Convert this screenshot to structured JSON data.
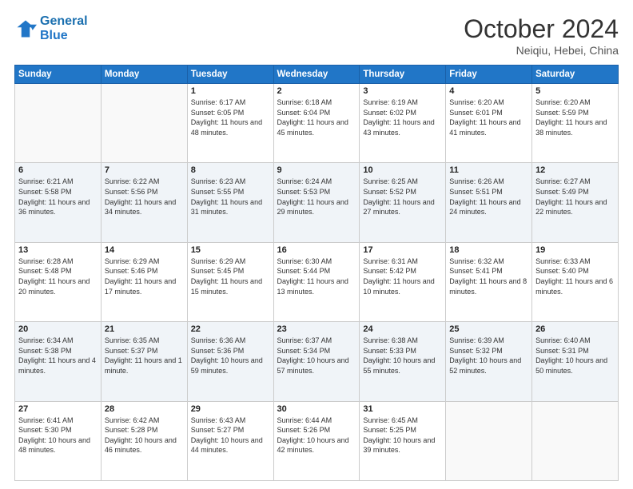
{
  "header": {
    "logo_line1": "General",
    "logo_line2": "Blue",
    "month": "October 2024",
    "location": "Neiqiu, Hebei, China"
  },
  "weekdays": [
    "Sunday",
    "Monday",
    "Tuesday",
    "Wednesday",
    "Thursday",
    "Friday",
    "Saturday"
  ],
  "weeks": [
    [
      {
        "day": "",
        "info": ""
      },
      {
        "day": "",
        "info": ""
      },
      {
        "day": "1",
        "info": "Sunrise: 6:17 AM\nSunset: 6:05 PM\nDaylight: 11 hours and 48 minutes."
      },
      {
        "day": "2",
        "info": "Sunrise: 6:18 AM\nSunset: 6:04 PM\nDaylight: 11 hours and 45 minutes."
      },
      {
        "day": "3",
        "info": "Sunrise: 6:19 AM\nSunset: 6:02 PM\nDaylight: 11 hours and 43 minutes."
      },
      {
        "day": "4",
        "info": "Sunrise: 6:20 AM\nSunset: 6:01 PM\nDaylight: 11 hours and 41 minutes."
      },
      {
        "day": "5",
        "info": "Sunrise: 6:20 AM\nSunset: 5:59 PM\nDaylight: 11 hours and 38 minutes."
      }
    ],
    [
      {
        "day": "6",
        "info": "Sunrise: 6:21 AM\nSunset: 5:58 PM\nDaylight: 11 hours and 36 minutes."
      },
      {
        "day": "7",
        "info": "Sunrise: 6:22 AM\nSunset: 5:56 PM\nDaylight: 11 hours and 34 minutes."
      },
      {
        "day": "8",
        "info": "Sunrise: 6:23 AM\nSunset: 5:55 PM\nDaylight: 11 hours and 31 minutes."
      },
      {
        "day": "9",
        "info": "Sunrise: 6:24 AM\nSunset: 5:53 PM\nDaylight: 11 hours and 29 minutes."
      },
      {
        "day": "10",
        "info": "Sunrise: 6:25 AM\nSunset: 5:52 PM\nDaylight: 11 hours and 27 minutes."
      },
      {
        "day": "11",
        "info": "Sunrise: 6:26 AM\nSunset: 5:51 PM\nDaylight: 11 hours and 24 minutes."
      },
      {
        "day": "12",
        "info": "Sunrise: 6:27 AM\nSunset: 5:49 PM\nDaylight: 11 hours and 22 minutes."
      }
    ],
    [
      {
        "day": "13",
        "info": "Sunrise: 6:28 AM\nSunset: 5:48 PM\nDaylight: 11 hours and 20 minutes."
      },
      {
        "day": "14",
        "info": "Sunrise: 6:29 AM\nSunset: 5:46 PM\nDaylight: 11 hours and 17 minutes."
      },
      {
        "day": "15",
        "info": "Sunrise: 6:29 AM\nSunset: 5:45 PM\nDaylight: 11 hours and 15 minutes."
      },
      {
        "day": "16",
        "info": "Sunrise: 6:30 AM\nSunset: 5:44 PM\nDaylight: 11 hours and 13 minutes."
      },
      {
        "day": "17",
        "info": "Sunrise: 6:31 AM\nSunset: 5:42 PM\nDaylight: 11 hours and 10 minutes."
      },
      {
        "day": "18",
        "info": "Sunrise: 6:32 AM\nSunset: 5:41 PM\nDaylight: 11 hours and 8 minutes."
      },
      {
        "day": "19",
        "info": "Sunrise: 6:33 AM\nSunset: 5:40 PM\nDaylight: 11 hours and 6 minutes."
      }
    ],
    [
      {
        "day": "20",
        "info": "Sunrise: 6:34 AM\nSunset: 5:38 PM\nDaylight: 11 hours and 4 minutes."
      },
      {
        "day": "21",
        "info": "Sunrise: 6:35 AM\nSunset: 5:37 PM\nDaylight: 11 hours and 1 minute."
      },
      {
        "day": "22",
        "info": "Sunrise: 6:36 AM\nSunset: 5:36 PM\nDaylight: 10 hours and 59 minutes."
      },
      {
        "day": "23",
        "info": "Sunrise: 6:37 AM\nSunset: 5:34 PM\nDaylight: 10 hours and 57 minutes."
      },
      {
        "day": "24",
        "info": "Sunrise: 6:38 AM\nSunset: 5:33 PM\nDaylight: 10 hours and 55 minutes."
      },
      {
        "day": "25",
        "info": "Sunrise: 6:39 AM\nSunset: 5:32 PM\nDaylight: 10 hours and 52 minutes."
      },
      {
        "day": "26",
        "info": "Sunrise: 6:40 AM\nSunset: 5:31 PM\nDaylight: 10 hours and 50 minutes."
      }
    ],
    [
      {
        "day": "27",
        "info": "Sunrise: 6:41 AM\nSunset: 5:30 PM\nDaylight: 10 hours and 48 minutes."
      },
      {
        "day": "28",
        "info": "Sunrise: 6:42 AM\nSunset: 5:28 PM\nDaylight: 10 hours and 46 minutes."
      },
      {
        "day": "29",
        "info": "Sunrise: 6:43 AM\nSunset: 5:27 PM\nDaylight: 10 hours and 44 minutes."
      },
      {
        "day": "30",
        "info": "Sunrise: 6:44 AM\nSunset: 5:26 PM\nDaylight: 10 hours and 42 minutes."
      },
      {
        "day": "31",
        "info": "Sunrise: 6:45 AM\nSunset: 5:25 PM\nDaylight: 10 hours and 39 minutes."
      },
      {
        "day": "",
        "info": ""
      },
      {
        "day": "",
        "info": ""
      }
    ]
  ]
}
